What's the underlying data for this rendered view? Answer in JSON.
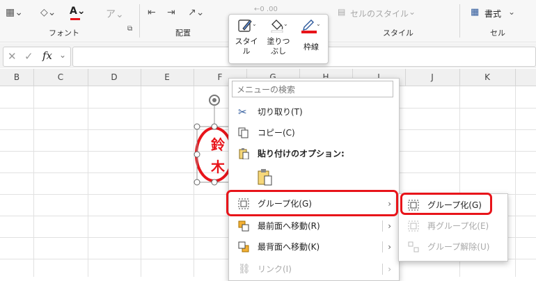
{
  "ribbon": {
    "groups": [
      {
        "name": "フォント"
      },
      {
        "name": "配置"
      },
      {
        "name": "スタイル"
      },
      {
        "name": "セル"
      }
    ],
    "cell_styles_label": "セルのスタイル",
    "format_label": "書式",
    "number_hint": "←0  .00"
  },
  "formula_bar": {
    "fx_label": "fx",
    "value": ""
  },
  "columns": [
    "B",
    "C",
    "D",
    "E",
    "F",
    "G",
    "H",
    "I",
    "J",
    "K"
  ],
  "seal": {
    "chars": [
      "鈴",
      "木"
    ],
    "color": "#e8141a"
  },
  "mini_toolbar": {
    "style_label": "スタイ\nル",
    "fill_label": "塗りつ\nぶし",
    "border_label": "枠線"
  },
  "context_menu": {
    "search_placeholder": "メニューの検索",
    "items": [
      {
        "label": "切り取り(T)",
        "icon": "scissors-icon"
      },
      {
        "label": "コピー(C)",
        "icon": "copy-icon"
      },
      {
        "label": "貼り付けのオプション:",
        "icon": "paste-icon"
      },
      {
        "label": "グループ化(G)",
        "icon": "group-icon",
        "submenu": true,
        "highlighted": true
      },
      {
        "label": "最前面へ移動(R)",
        "icon": "bring-front-icon",
        "submenu": true
      },
      {
        "label": "最背面へ移動(K)",
        "icon": "send-back-icon",
        "submenu": true
      },
      {
        "label": "リンク(I)",
        "icon": "link-icon",
        "submenu": true,
        "disabled": true
      }
    ]
  },
  "submenu": {
    "items": [
      {
        "label": "グループ化(G)",
        "icon": "group-icon",
        "highlighted": true
      },
      {
        "label": "再グループ化(E)",
        "icon": "regroup-icon",
        "disabled": true
      },
      {
        "label": "グループ解除(U)",
        "icon": "ungroup-icon",
        "disabled": true
      }
    ]
  },
  "colors": {
    "highlight": "#e8141a",
    "accent_red": "#e8141a"
  }
}
